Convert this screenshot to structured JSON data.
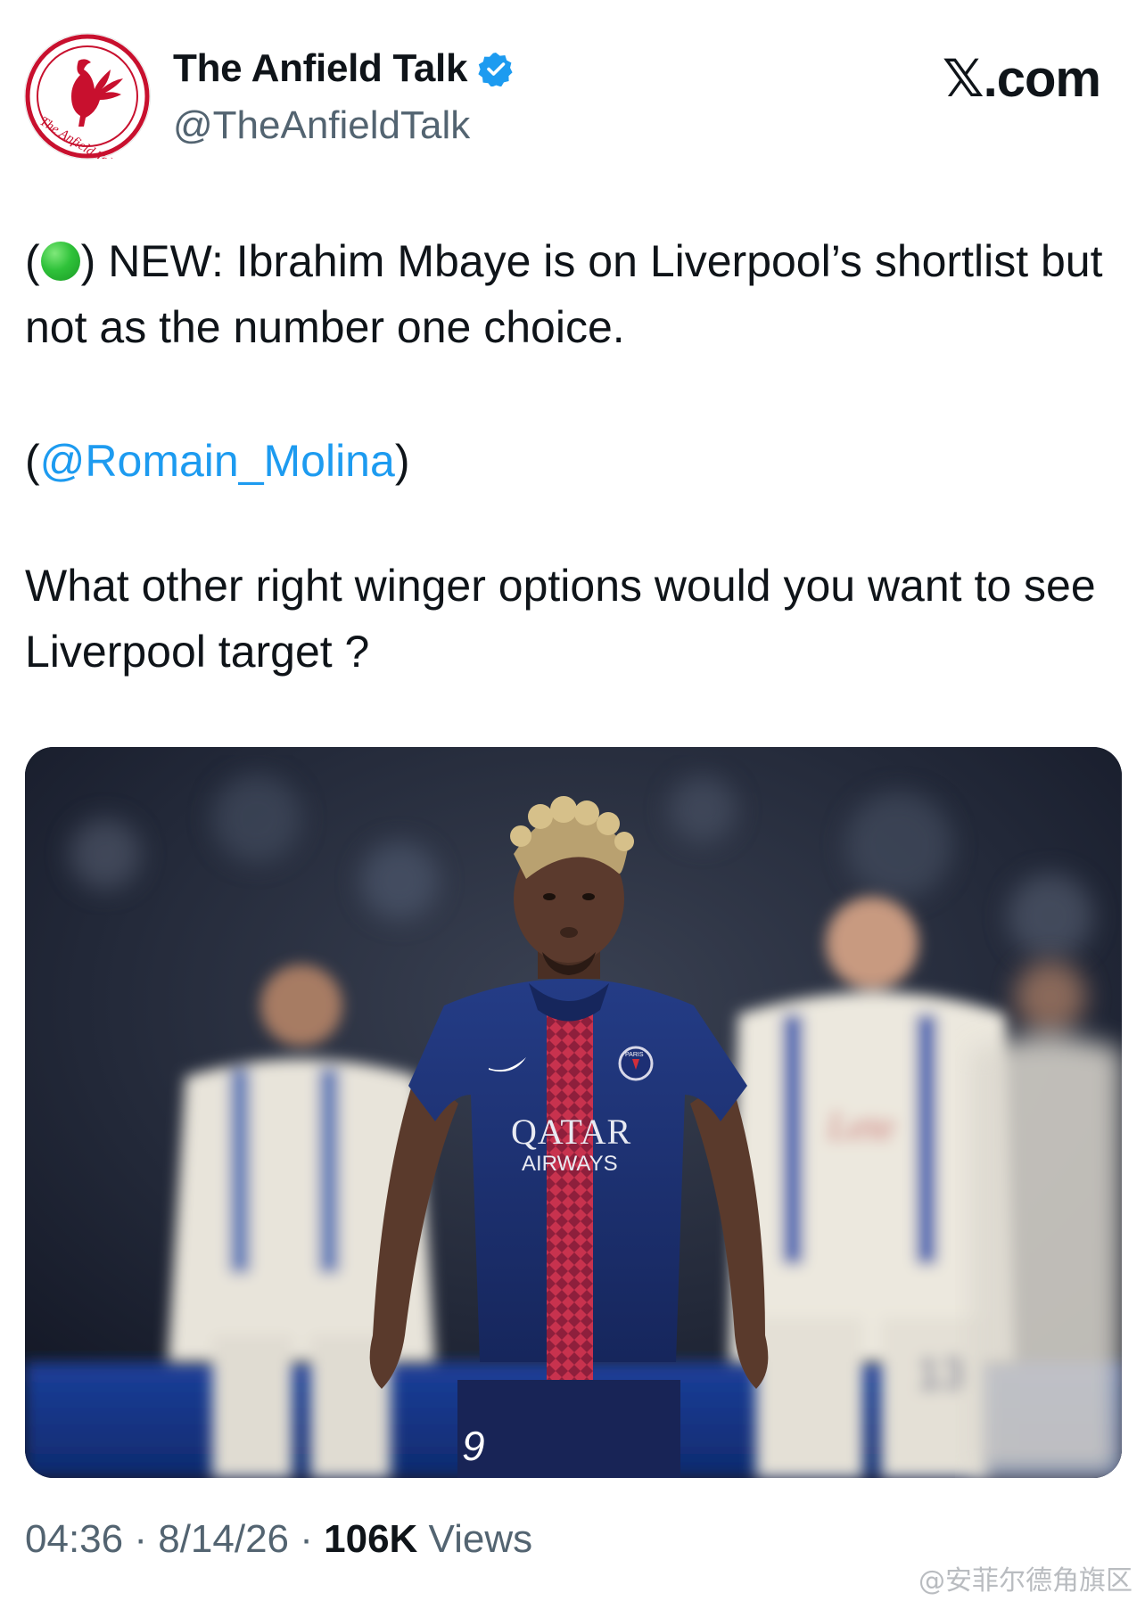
{
  "header": {
    "display_name": "The Anfield Talk",
    "handle": "@TheAnfieldTalk",
    "verified": true,
    "brand": "𝕏.com",
    "avatar_text": "The Anfield Talk",
    "avatar_icon": "liverbird-icon"
  },
  "tweet": {
    "line1_open": "(",
    "status_dot": "green-circle",
    "line1_close": ") NEW: Ibrahim Mbaye is on Liverpool’s shortlist but not as the number one choice.",
    "line2_open": "(",
    "mention": "@Romain_Molina",
    "line2_close": ")",
    "line3": "What other right winger options would you want to see Liverpool target ?"
  },
  "media": {
    "shirt_sponsor_line1": "QATAR",
    "shirt_sponsor_line2": "AIRWAYS",
    "shirt_number": "9",
    "opponent_sponsor": "Lete",
    "opponent_number": "13",
    "club_badge": "PARIS"
  },
  "meta": {
    "time": "04:36",
    "separator": " · ",
    "date": "8/14/26",
    "views_count": "106K",
    "views_label": " Views"
  },
  "watermark": "@安菲尔德角旗区",
  "colors": {
    "link": "#1d9bf0",
    "secondary_text": "#536471",
    "verified": "#1d9bf0",
    "avatar_red": "#c8102e"
  }
}
